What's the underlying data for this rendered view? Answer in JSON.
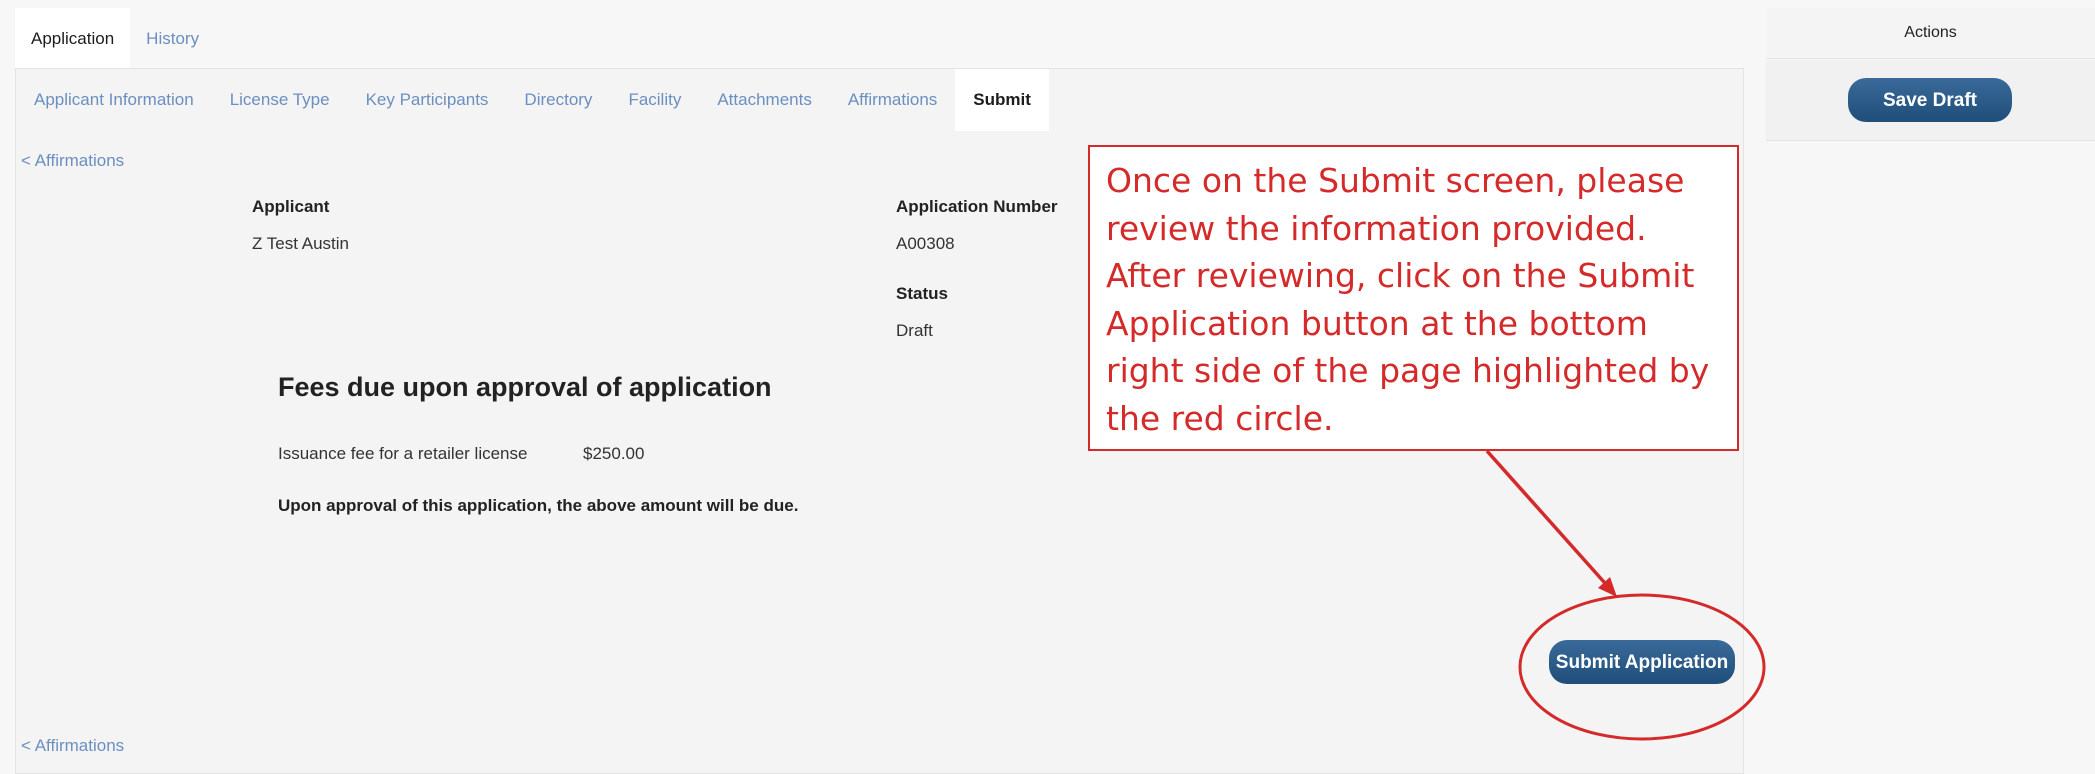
{
  "top_tabs": [
    {
      "label": "Application",
      "active": true
    },
    {
      "label": "History",
      "active": false
    }
  ],
  "sub_tabs": [
    {
      "label": "Applicant Information",
      "active": false
    },
    {
      "label": "License Type",
      "active": false
    },
    {
      "label": "Key Participants",
      "active": false
    },
    {
      "label": "Directory",
      "active": false
    },
    {
      "label": "Facility",
      "active": false
    },
    {
      "label": "Attachments",
      "active": false
    },
    {
      "label": "Affirmations",
      "active": false
    },
    {
      "label": "Submit",
      "active": true
    }
  ],
  "nav": {
    "back_top": "< Affirmations",
    "back_bottom": "< Affirmations"
  },
  "applicant": {
    "label": "Applicant",
    "value": "Z Test Austin"
  },
  "application_number": {
    "label": "Application Number",
    "value": "A00308"
  },
  "status": {
    "label": "Status",
    "value": "Draft"
  },
  "fees": {
    "title": "Fees due upon approval of application",
    "items": [
      {
        "name": "Issuance fee for a retailer license",
        "amount": "$250.00"
      }
    ],
    "note": "Upon approval of this application, the above amount will be due."
  },
  "submit_button": "Submit Application",
  "actions": {
    "header": "Actions",
    "save_draft": "Save Draft"
  },
  "annotation": {
    "text": "Once on the Submit screen, please review the information provided. After reviewing, click on the Submit Application button at the bottom right side of the page highlighted by the red circle.",
    "color": "#d42a2a"
  },
  "colors": {
    "accent": "#1f4e7a",
    "link": "#6b8fc0",
    "annotation": "#d42a2a"
  }
}
